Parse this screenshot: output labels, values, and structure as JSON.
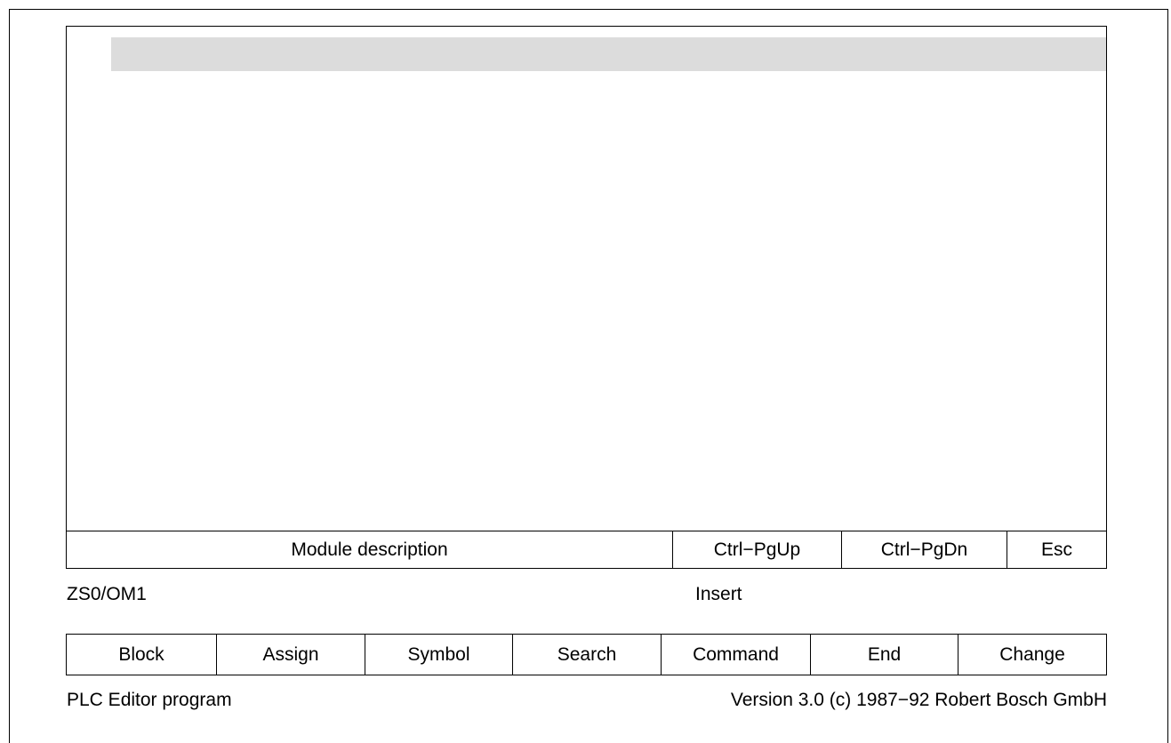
{
  "screen": {
    "footer": {
      "description": "Module description",
      "prev_page": "Ctrl−PgUp",
      "next_page": "Ctrl−PgDn",
      "escape": "Esc"
    }
  },
  "status": {
    "location": "ZS0/OM1",
    "mode": "Insert"
  },
  "softkeys": [
    {
      "label": "Block"
    },
    {
      "label": "Assign"
    },
    {
      "label": "Symbol"
    },
    {
      "label": "Search"
    },
    {
      "label": "Command"
    },
    {
      "label": "End"
    },
    {
      "label": "Change"
    }
  ],
  "footer": {
    "program": "PLC Editor program",
    "version": "Version 3.0 (c) 1987−92 Robert Bosch GmbH"
  }
}
